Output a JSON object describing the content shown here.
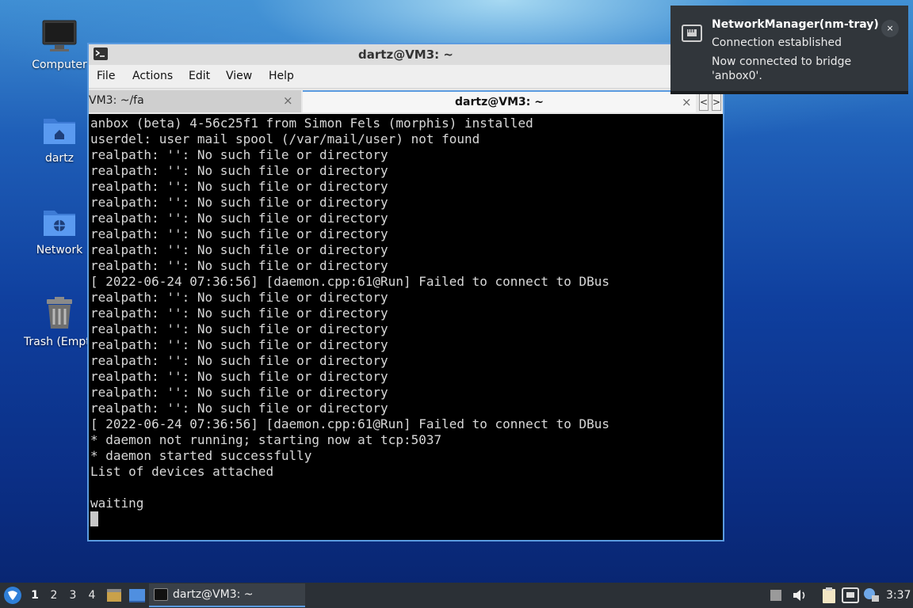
{
  "desktop": {
    "icons": [
      {
        "label": "Computer",
        "icon": "computer-icon"
      },
      {
        "label": "dartz",
        "icon": "home-folder-icon"
      },
      {
        "label": "Network",
        "icon": "network-folder-icon"
      },
      {
        "label": "Trash (Empty)",
        "icon": "trash-icon"
      }
    ]
  },
  "window": {
    "title": "dartz@VM3: ~",
    "menu": [
      "File",
      "Actions",
      "Edit",
      "View",
      "Help"
    ],
    "tabs": [
      {
        "label": "VM3: ~/fa",
        "active": false
      },
      {
        "label": "dartz@VM3: ~",
        "active": true
      }
    ],
    "close_glyph": "×",
    "scroll_left": "<",
    "scroll_right": ">",
    "lines": [
      "anbox (beta) 4-56c25f1 from Simon Fels (morphis) installed",
      "userdel: user mail spool (/var/mail/user) not found",
      "realpath: '': No such file or directory",
      "realpath: '': No such file or directory",
      "realpath: '': No such file or directory",
      "realpath: '': No such file or directory",
      "realpath: '': No such file or directory",
      "realpath: '': No such file or directory",
      "realpath: '': No such file or directory",
      "realpath: '': No such file or directory",
      "[ 2022-06-24 07:36:56] [daemon.cpp:61@Run] Failed to connect to DBus",
      "realpath: '': No such file or directory",
      "realpath: '': No such file or directory",
      "realpath: '': No such file or directory",
      "realpath: '': No such file or directory",
      "realpath: '': No such file or directory",
      "realpath: '': No such file or directory",
      "realpath: '': No such file or directory",
      "realpath: '': No such file or directory",
      "[ 2022-06-24 07:36:56] [daemon.cpp:61@Run] Failed to connect to DBus",
      "* daemon not running; starting now at tcp:5037",
      "* daemon started successfully",
      "List of devices attached",
      "",
      "waiting"
    ]
  },
  "notification": {
    "title": "NetworkManager(nm-tray)",
    "summary": "Connection established",
    "body": "Now connected to bridge 'anbox0'.",
    "close_glyph": "×"
  },
  "taskbar": {
    "desktops": [
      "1",
      "2",
      "3",
      "4"
    ],
    "active_desktop": "1",
    "task_label": "dartz@VM3: ~",
    "clock": "3:37"
  },
  "colors": {
    "accent": "#5b9be0",
    "panel": "#2b3036",
    "notification_bg": "#31363b",
    "terminal_bg": "#000000",
    "terminal_fg": "#d8d8d8"
  }
}
